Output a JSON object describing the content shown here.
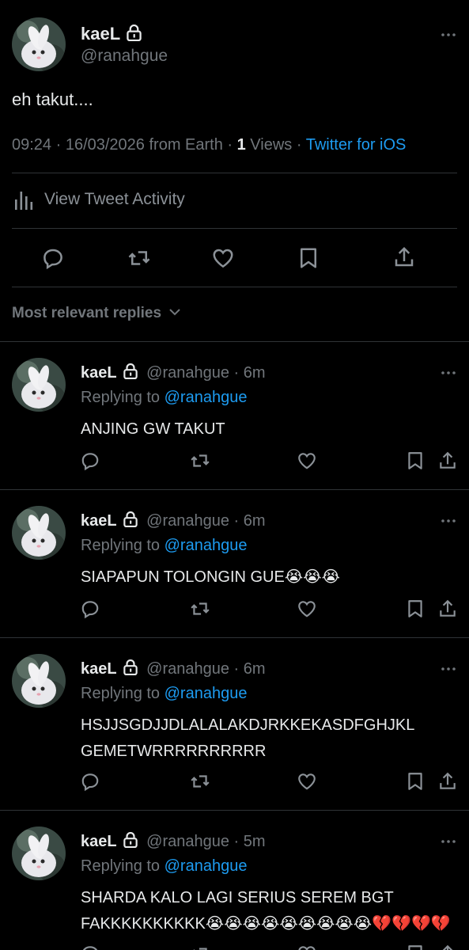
{
  "main_tweet": {
    "name": "kaeL",
    "handle": "@ranahgue",
    "text": "eh takut....",
    "time": "09:24 · 16/03/2026 from Earth · ",
    "views_count": "1",
    "views_label": " Views · ",
    "source": "Twitter for iOS",
    "activity_label": "View Tweet Activity",
    "sort_label": "Most relevant replies"
  },
  "replies": [
    {
      "name": "kaeL",
      "handle": "@ranahgue",
      "time": "· 6m",
      "replying_prefix": "Replying to ",
      "replying_handle": "@ranahgue",
      "text": "ANJING GW TAKUT"
    },
    {
      "name": "kaeL",
      "handle": "@ranahgue",
      "time": "· 6m",
      "replying_prefix": "Replying to ",
      "replying_handle": "@ranahgue",
      "text": "SIAPAPUN TOLONGIN GUE😭😭😭"
    },
    {
      "name": "kaeL",
      "handle": "@ranahgue",
      "time": "· 6m",
      "replying_prefix": "Replying to ",
      "replying_handle": "@ranahgue",
      "text": "HSJJSGDJJDLALALAKDJRKKEKASDFGHJKL GEMETWRRRRRRRRRR"
    },
    {
      "name": "kaeL",
      "handle": "@ranahgue",
      "time": "· 5m",
      "replying_prefix": "Replying to ",
      "replying_handle": "@ranahgue",
      "text": "SHARDA KALO LAGI SERIUS SEREM BGT FAKKKKKKKKKK😭😭😭😭😭😭😭😭😭💔💔💔💔"
    }
  ],
  "icons": {
    "reply": "reply-icon",
    "retweet": "retweet-icon",
    "like": "heart-icon",
    "bookmark": "bookmark-icon",
    "share": "share-icon",
    "lock": "lock-icon",
    "more": "more-icon",
    "activity": "activity-icon",
    "chevron": "chevron-down-icon"
  },
  "colors": {
    "background": "#000000",
    "text": "#e7e9ea",
    "secondary": "#71767b",
    "link": "#1d9bf0",
    "divider": "#2f3336"
  }
}
